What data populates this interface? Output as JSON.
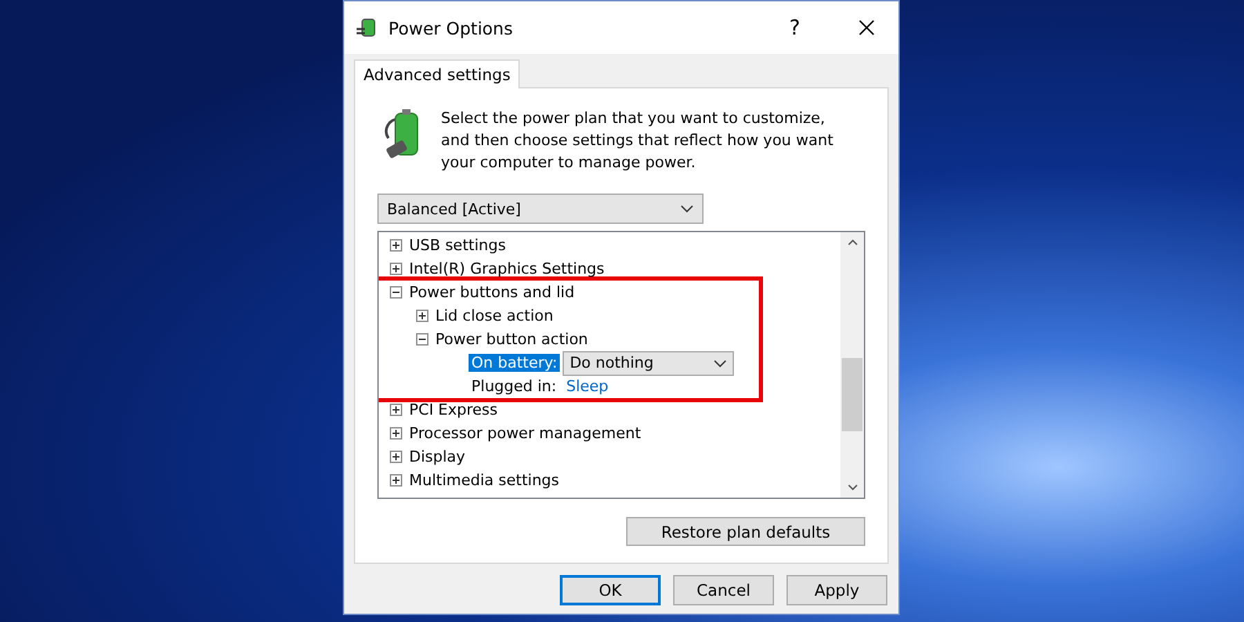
{
  "window": {
    "title": "Power Options",
    "help": "?"
  },
  "tabs": [
    {
      "label": "Advanced settings",
      "selected": true
    }
  ],
  "intro": "Select the power plan that you want to customize, and then choose settings that reflect how you want your computer to manage power.",
  "plan_select": {
    "value": "Balanced [Active]"
  },
  "tree": [
    {
      "kind": "group",
      "label": "USB settings",
      "expanded": false,
      "highlighted": false
    },
    {
      "kind": "group",
      "label": "Intel(R) Graphics Settings",
      "expanded": false,
      "highlighted": false
    },
    {
      "kind": "group",
      "label": "Power buttons and lid",
      "expanded": true,
      "highlighted": true,
      "children": [
        {
          "kind": "group",
          "label": "Lid close action",
          "expanded": false
        },
        {
          "kind": "group",
          "label": "Power button action",
          "expanded": true,
          "children": [
            {
              "kind": "dropdown",
              "label": "On battery:",
              "value": "Do nothing",
              "selected": true
            },
            {
              "kind": "link",
              "label": "Plugged in:",
              "value": "Sleep",
              "selected": false
            }
          ]
        }
      ]
    },
    {
      "kind": "group",
      "label": "PCI Express",
      "expanded": false,
      "highlighted": false
    },
    {
      "kind": "group",
      "label": "Processor power management",
      "expanded": false,
      "highlighted": false
    },
    {
      "kind": "group",
      "label": "Display",
      "expanded": false,
      "highlighted": false
    },
    {
      "kind": "group",
      "label": "Multimedia settings",
      "expanded": false,
      "highlighted": false
    }
  ],
  "restore_button": "Restore plan defaults",
  "buttons": [
    {
      "label": "OK",
      "default": true
    },
    {
      "label": "Cancel",
      "default": false
    },
    {
      "label": "Apply",
      "default": false
    }
  ]
}
